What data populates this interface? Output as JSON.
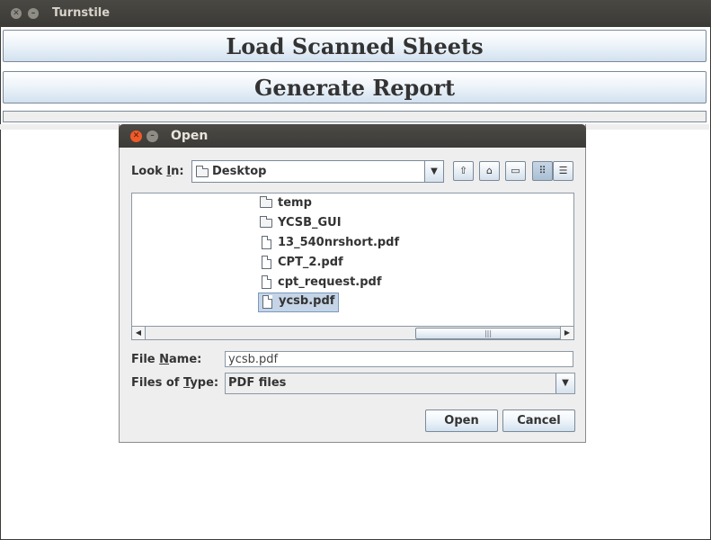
{
  "main_window": {
    "title": "Turnstile",
    "load_button": "Load Scanned Sheets",
    "report_button": "Generate Report"
  },
  "dialog": {
    "title": "Open",
    "look_in_label_pre": "Look ",
    "look_in_label_key": "I",
    "look_in_label_post": "n:",
    "look_in_value": "Desktop",
    "files": [
      {
        "name": "temp",
        "type": "folder"
      },
      {
        "name": "YCSB_GUI",
        "type": "folder"
      },
      {
        "name": "13_540nrshort.pdf",
        "type": "file"
      },
      {
        "name": "CPT_2.pdf",
        "type": "file"
      },
      {
        "name": "cpt_request.pdf",
        "type": "file"
      },
      {
        "name": "ycsb.pdf",
        "type": "file",
        "selected": true
      }
    ],
    "file_name_label_pre": "File ",
    "file_name_label_key": "N",
    "file_name_label_post": "ame:",
    "file_name_value": "ycsb.pdf",
    "file_type_label_pre": "Files of ",
    "file_type_label_key": "T",
    "file_type_label_post": "ype:",
    "file_type_value": "PDF files",
    "open_label": "Open",
    "cancel_label": "Cancel"
  },
  "icons": {
    "close": "close-icon",
    "minimize": "minimize-icon",
    "up_folder": "up-folder-icon",
    "home": "home-icon",
    "new_folder": "new-folder-icon",
    "list_view": "list-view-icon",
    "details_view": "details-view-icon"
  },
  "colors": {
    "titlebar": "#3c3b37",
    "close_button": "#f05a28",
    "selection": "#c5d5e7"
  }
}
